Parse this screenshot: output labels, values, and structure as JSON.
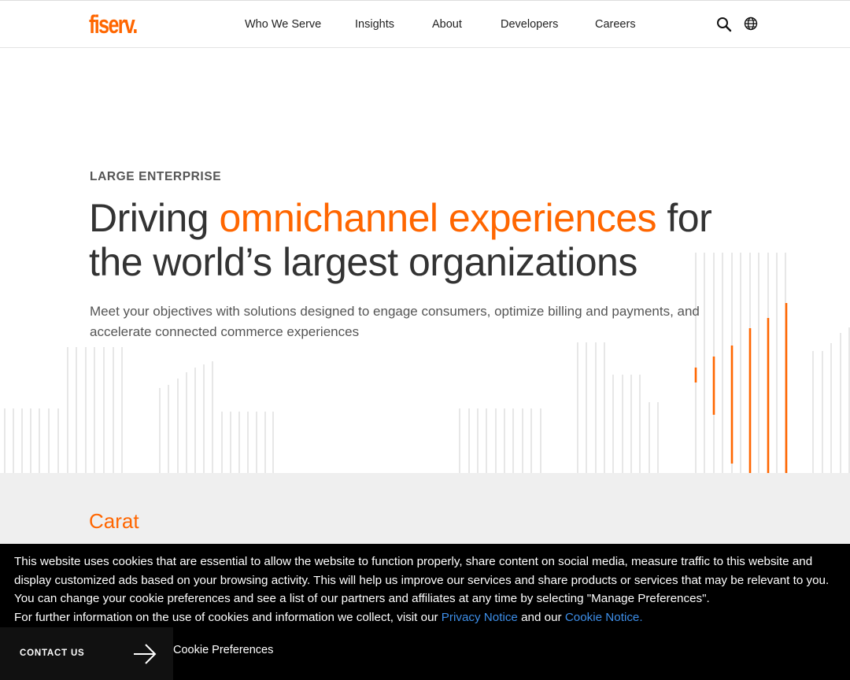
{
  "brand": {
    "logo_text": "fiserv.",
    "accent_color": "#ff6600"
  },
  "nav": {
    "items": [
      {
        "label": "Who We Serve"
      },
      {
        "label": "Insights"
      },
      {
        "label": "About"
      },
      {
        "label": "Developers"
      },
      {
        "label": "Careers"
      }
    ],
    "icons": [
      "search-icon",
      "globe-icon"
    ]
  },
  "hero": {
    "eyebrow": "LARGE ENTERPRISE",
    "headline_part1": "Driving ",
    "headline_accent": "omnichannel experiences",
    "headline_part2": " for the world’s largest organizations",
    "subtext": "Meet your objectives with solutions designed to engage consumers, optimize billing and payments, and accelerate connected commerce experiences"
  },
  "section": {
    "title": "Carat"
  },
  "cookie_banner": {
    "line1": "This website uses cookies that are essential to allow the website to function properly, share content on social media, measure traffic to this website and display customized ads based on your browsing activity. This will help us improve our services and share products or services that may be relevant to you. You can change your cookie preferences and see a list of our partners and affiliates at any time by selecting \"Manage Preferences\".",
    "line2_prefix": "For further information on the use of cookies and information we collect, visit our ",
    "privacy_link": "Privacy Notice",
    "line2_mid": " and our ",
    "cookie_link": "Cookie Notice.",
    "preferences_label": "Cookie Preferences",
    "link_color": "#3d8ee8"
  },
  "contact": {
    "label": "CONTACT US",
    "icon": "arrow-right-icon"
  }
}
